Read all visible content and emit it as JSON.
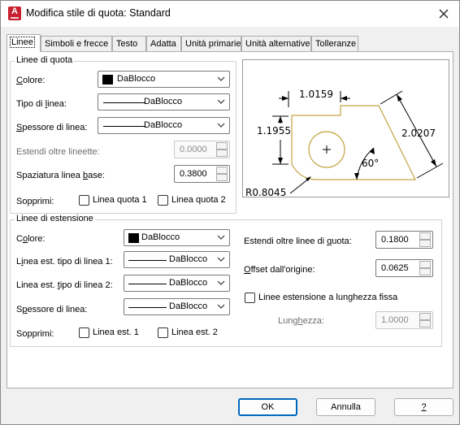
{
  "window": {
    "title": "Modifica stile di quota: Standard",
    "app_icon_letter": "A"
  },
  "tabs": [
    {
      "label": "Linee"
    },
    {
      "label": "Simboli e frecce"
    },
    {
      "label": "Testo"
    },
    {
      "label": "Adatta"
    },
    {
      "label": "Unità primarie"
    },
    {
      "label": "Unità alternative"
    },
    {
      "label": "Tolleranze"
    }
  ],
  "dim_lines": {
    "title": "Linee di quota",
    "color_label": "Colore:",
    "color_value": "DaBlocco",
    "linetype_label": "Tipo di linea:",
    "linetype_value": "DaBlocco",
    "lineweight_label": "Spessore di linea:",
    "lineweight_value": "DaBlocco",
    "extend_label": "Estendi oltre lineette:",
    "extend_value": "0.0000",
    "baseline_label": "Spaziatura linea base:",
    "baseline_value": "0.3800",
    "suppress_label": "Sopprimi:",
    "suppress_1": "Linea quota 1",
    "suppress_2": "Linea quota 2"
  },
  "ext_lines": {
    "title": "Linee di estensione",
    "color_label": "Colore:",
    "color_value": "DaBlocco",
    "lt1_label": "Linea est. tipo di linea 1:",
    "lt1_value": "DaBlocco",
    "lt2_label": "Linea est. tipo di linea 2:",
    "lt2_value": "DaBlocco",
    "lineweight_label": "Spessore di linea:",
    "lineweight_value": "DaBlocco",
    "suppress_label": "Sopprimi:",
    "suppress_1": "Linea est. 1",
    "suppress_2": "Linea est. 2",
    "extend_label": "Estendi oltre linee di quota:",
    "extend_value": "0.1800",
    "offset_label": "Offset dall'origine:",
    "offset_value": "0.0625",
    "fixed_label": "Linee estensione a lunghezza fissa",
    "length_label": "Lunghezza:",
    "length_value": "1.0000"
  },
  "preview": {
    "dim_top": "1.0159",
    "dim_left": "1.1955",
    "dim_right": "2.0207",
    "angle": "60°",
    "radius": "R0.8045"
  },
  "buttons": {
    "ok": "OK",
    "cancel": "Annulla",
    "help": "?"
  }
}
